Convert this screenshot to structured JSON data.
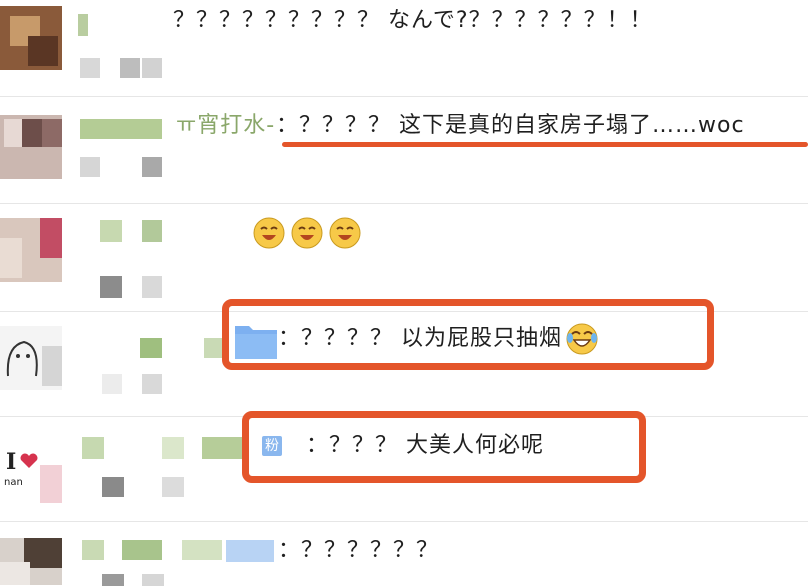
{
  "comments": [
    {
      "name": "",
      "text": "？？？？？？？？？ なんで?？？？？？？！！"
    },
    {
      "name": "ㅠ宵打水-",
      "text": "：？？？？ 这下是真的自家房子塌了……woc"
    },
    {
      "name": "",
      "text": ""
    },
    {
      "name": "",
      "text": "：？？？？ 以为屁股只抽烟"
    },
    {
      "name": "粉",
      "text": "：？？？ 大美人何必呢"
    },
    {
      "name": "",
      "text": "：？？？？？？"
    }
  ],
  "colors": {
    "highlight": "#e4552a",
    "name": "#7a8f5a",
    "divider": "#e6e6e6",
    "tag": "#8ab7ee"
  },
  "icons": [
    "laugh-emoji-icon",
    "tears-of-joy-emoji-icon",
    "folder-icon"
  ],
  "avatar_text": "I",
  "avatar_subtext": "nan"
}
